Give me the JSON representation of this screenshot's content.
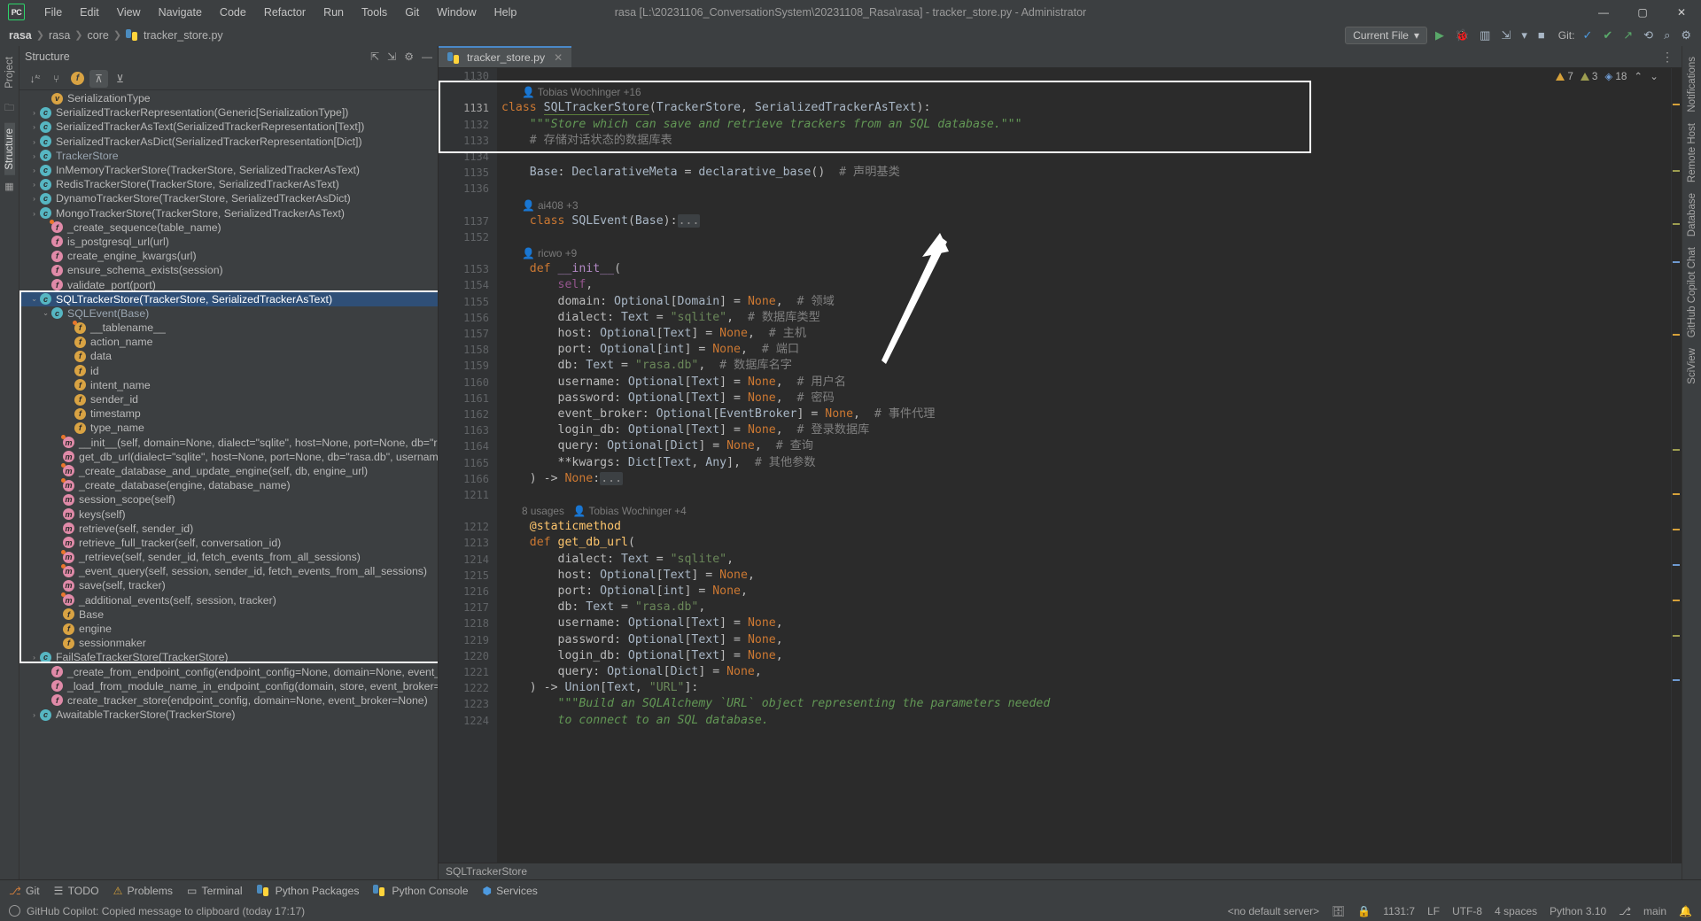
{
  "window": {
    "app_initials": "PC",
    "title": "rasa [L:\\20231106_ConversationSystem\\20231108_Rasa\\rasa] - tracker_store.py - Administrator",
    "controls": {
      "minimize": "—",
      "maximize": "▢",
      "close": "✕"
    }
  },
  "menu": [
    "File",
    "Edit",
    "View",
    "Navigate",
    "Code",
    "Refactor",
    "Run",
    "Tools",
    "Git",
    "Window",
    "Help"
  ],
  "breadcrumb": {
    "items": [
      "rasa",
      "rasa",
      "core"
    ],
    "file": "tracker_store.py",
    "file_icon": "python-file-icon"
  },
  "navbar_right": {
    "run_config": "Current File",
    "chevron": "▾",
    "run": "▶",
    "debug": "bug-icon",
    "coverage": "coverage-icon",
    "profile": "profile-icon",
    "more": "▾",
    "stop": "■",
    "git_label": "Git:",
    "git_update": "✓",
    "git_commit": "✔",
    "git_push": "↗",
    "history": "⟲",
    "search_everywhere": "⌕",
    "settings": "⚙",
    "menu_more": "⋮"
  },
  "structure": {
    "title": "Structure",
    "header_icons": [
      "expand-all-icon",
      "collapse-all-icon",
      "settings-icon",
      "hide-icon"
    ],
    "toolbar": [
      {
        "name": "sort-alphabetically-icon",
        "glyph": "↓ᴬᶻ",
        "active": false
      },
      {
        "name": "sort-by-visibility-icon",
        "glyph": "⑂",
        "active": false
      },
      {
        "name": "show-fields-icon",
        "glyph": "f",
        "active": true
      },
      {
        "name": "show-inherited-icon",
        "glyph": "⊼",
        "active": true
      },
      {
        "name": "show-non-public-icon",
        "glyph": "⊻",
        "active": false
      }
    ],
    "nodes": [
      {
        "indent": 1,
        "arrow": "",
        "kind": "var",
        "label": "SerializationType",
        "muted": false
      },
      {
        "indent": 0,
        "arrow": "›",
        "kind": "class",
        "label": "SerializedTrackerRepresentation(Generic[SerializationType])",
        "muted": false
      },
      {
        "indent": 0,
        "arrow": "›",
        "kind": "class",
        "label": "SerializedTrackerAsText(SerializedTrackerRepresentation[Text])",
        "muted": false
      },
      {
        "indent": 0,
        "arrow": "›",
        "kind": "class",
        "label": "SerializedTrackerAsDict(SerializedTrackerRepresentation[Dict])",
        "muted": false
      },
      {
        "indent": 0,
        "arrow": "›",
        "kind": "class",
        "label": "TrackerStore",
        "muted": true
      },
      {
        "indent": 0,
        "arrow": "›",
        "kind": "class",
        "label": "InMemoryTrackerStore(TrackerStore, SerializedTrackerAsText)",
        "muted": false
      },
      {
        "indent": 0,
        "arrow": "›",
        "kind": "class",
        "label": "RedisTrackerStore(TrackerStore, SerializedTrackerAsText)",
        "muted": false
      },
      {
        "indent": 0,
        "arrow": "›",
        "kind": "class",
        "label": "DynamoTrackerStore(TrackerStore, SerializedTrackerAsDict)",
        "muted": false
      },
      {
        "indent": 0,
        "arrow": "›",
        "kind": "class",
        "label": "MongoTrackerStore(TrackerStore, SerializedTrackerAsText)",
        "muted": false
      },
      {
        "indent": 1,
        "arrow": "",
        "kind": "func",
        "label": "_create_sequence(table_name)",
        "dot": true
      },
      {
        "indent": 1,
        "arrow": "",
        "kind": "func",
        "label": "is_postgresql_url(url)"
      },
      {
        "indent": 1,
        "arrow": "",
        "kind": "func",
        "label": "create_engine_kwargs(url)"
      },
      {
        "indent": 1,
        "arrow": "",
        "kind": "func",
        "label": "ensure_schema_exists(session)"
      },
      {
        "indent": 1,
        "arrow": "",
        "kind": "func",
        "label": "validate_port(port)"
      },
      {
        "indent": 0,
        "arrow": "⌄",
        "kind": "class",
        "label": "SQLTrackerStore(TrackerStore, SerializedTrackerAsText)",
        "selected": true
      },
      {
        "indent": 1,
        "arrow": "⌄",
        "kind": "class",
        "label": "SQLEvent(Base)",
        "muted": true
      },
      {
        "indent": 3,
        "arrow": "",
        "kind": "field",
        "label": "__tablename__",
        "dot": true
      },
      {
        "indent": 3,
        "arrow": "",
        "kind": "field",
        "label": "action_name"
      },
      {
        "indent": 3,
        "arrow": "",
        "kind": "field",
        "label": "data"
      },
      {
        "indent": 3,
        "arrow": "",
        "kind": "field",
        "label": "id"
      },
      {
        "indent": 3,
        "arrow": "",
        "kind": "field",
        "label": "intent_name"
      },
      {
        "indent": 3,
        "arrow": "",
        "kind": "field",
        "label": "sender_id"
      },
      {
        "indent": 3,
        "arrow": "",
        "kind": "field",
        "label": "timestamp"
      },
      {
        "indent": 3,
        "arrow": "",
        "kind": "field",
        "label": "type_name"
      },
      {
        "indent": 2,
        "arrow": "",
        "kind": "meth",
        "label": "__init__(self, domain=None, dialect=\"sqlite\", host=None, port=None, db=\"rasa.db\", usern",
        "dot": true
      },
      {
        "indent": 2,
        "arrow": "",
        "kind": "meth",
        "label": "get_db_url(dialect=\"sqlite\", host=None, port=None, db=\"rasa.db\", username=None, pass"
      },
      {
        "indent": 2,
        "arrow": "",
        "kind": "meth",
        "label": "_create_database_and_update_engine(self, db, engine_url)",
        "dot": true
      },
      {
        "indent": 2,
        "arrow": "",
        "kind": "meth",
        "label": "_create_database(engine, database_name)",
        "dot": true
      },
      {
        "indent": 2,
        "arrow": "",
        "kind": "meth",
        "label": "session_scope(self)"
      },
      {
        "indent": 2,
        "arrow": "",
        "kind": "meth",
        "label": "keys(self)"
      },
      {
        "indent": 2,
        "arrow": "",
        "kind": "meth",
        "label": "retrieve(self, sender_id)"
      },
      {
        "indent": 2,
        "arrow": "",
        "kind": "meth",
        "label": "retrieve_full_tracker(self, conversation_id)"
      },
      {
        "indent": 2,
        "arrow": "",
        "kind": "meth",
        "label": "_retrieve(self, sender_id, fetch_events_from_all_sessions)",
        "dot": true
      },
      {
        "indent": 2,
        "arrow": "",
        "kind": "meth",
        "label": "_event_query(self, session, sender_id, fetch_events_from_all_sessions)",
        "dot": true
      },
      {
        "indent": 2,
        "arrow": "",
        "kind": "meth",
        "label": "save(self, tracker)"
      },
      {
        "indent": 2,
        "arrow": "",
        "kind": "meth",
        "label": "_additional_events(self, session, tracker)",
        "dot": true
      },
      {
        "indent": 2,
        "arrow": "",
        "kind": "field",
        "label": "Base"
      },
      {
        "indent": 2,
        "arrow": "",
        "kind": "field",
        "label": "engine"
      },
      {
        "indent": 2,
        "arrow": "",
        "kind": "field",
        "label": "sessionmaker"
      },
      {
        "indent": 0,
        "arrow": "›",
        "kind": "class",
        "label": "FailSafeTrackerStore(TrackerStore)"
      },
      {
        "indent": 1,
        "arrow": "",
        "kind": "func",
        "label": "_create_from_endpoint_config(endpoint_config=None, domain=None, event_broker=None)"
      },
      {
        "indent": 1,
        "arrow": "",
        "kind": "func",
        "label": "_load_from_module_name_in_endpoint_config(domain, store, event_broker=None)"
      },
      {
        "indent": 1,
        "arrow": "",
        "kind": "func",
        "label": "create_tracker_store(endpoint_config, domain=None, event_broker=None)"
      },
      {
        "indent": 0,
        "arrow": "›",
        "kind": "class",
        "label": "AwaitableTrackerStore(TrackerStore)"
      }
    ]
  },
  "editor": {
    "tab": {
      "label": "tracker_store.py",
      "icon": "python-file-icon",
      "close": "✕"
    },
    "tabbar_right_icon": "⋮",
    "inspection": {
      "warnings": "7",
      "weak_warnings": "3",
      "typos": "18",
      "caret_up": "⌃",
      "caret_down": "⌄"
    },
    "footer_breadcrumb": "SQLTrackerStore",
    "lines": [
      {
        "num": "1130",
        "type": "blank",
        "text": ""
      },
      {
        "num": "",
        "type": "annot",
        "author": "Tobias Wochinger",
        "extra": "+16"
      },
      {
        "num": "1131",
        "type": "code",
        "html": "<span class='kw'>class</span> <span class='cls underline-cls'>SQLTrackerStore</span>(<span class='ty'>TrackerStore</span>, <span class='ty'>SerializedTrackerAsText</span>):"
      },
      {
        "num": "1132",
        "type": "code",
        "html": "    <span class='doc'>\"\"\"Store which can save and retrieve trackers from an SQL database.\"\"\"</span>"
      },
      {
        "num": "1133",
        "type": "code",
        "html": "    <span class='cmt'># 存储对话状态的数据库表</span>"
      },
      {
        "num": "1134",
        "type": "code",
        "html": ""
      },
      {
        "num": "1135",
        "type": "code",
        "html": "    <span class='id'>Base</span>: <span class='ty'>DeclarativeMeta</span> = <span class='id'>declarative_base</span>()  <span class='cmt'># 声明基类</span>"
      },
      {
        "num": "1136",
        "type": "code",
        "html": ""
      },
      {
        "num": "",
        "type": "annot",
        "author": "ai408",
        "extra": "+3"
      },
      {
        "num": "1137",
        "type": "code",
        "html": "    <span class='kw'>class</span> <span class='cls'>SQLEvent</span>(<span class='ty'>Base</span>):<span class='fold'>...</span>",
        "fold": true
      },
      {
        "num": "1152",
        "type": "code",
        "html": ""
      },
      {
        "num": "",
        "type": "annot",
        "author": "ricwo",
        "extra": "+9"
      },
      {
        "num": "1153",
        "type": "code",
        "html": "    <span class='kw'>def</span> <span class='mgc'>__init__</span>("
      },
      {
        "num": "1154",
        "type": "code",
        "html": "        <span class='self'>self</span>,"
      },
      {
        "num": "1155",
        "type": "code",
        "html": "        domain: <span class='ty'>Optional</span>[<span class='ty'>Domain</span>] = <span class='kw'>None</span>,  <span class='cmt'># 领域</span>"
      },
      {
        "num": "1156",
        "type": "code",
        "html": "        dialect: <span class='ty'>Text</span> = <span class='str'>\"sqlite\"</span>,  <span class='cmt'># 数据库类型</span>"
      },
      {
        "num": "1157",
        "type": "code",
        "html": "        host: <span class='ty'>Optional</span>[<span class='ty'>Text</span>] = <span class='kw'>None</span>,  <span class='cmt'># 主机</span>"
      },
      {
        "num": "1158",
        "type": "code",
        "html": "        port: <span class='ty'>Optional</span>[<span class='ty'>int</span>] = <span class='kw'>None</span>,  <span class='cmt'># 端口</span>"
      },
      {
        "num": "1159",
        "type": "code",
        "html": "        db: <span class='ty'>Text</span> = <span class='str'>\"rasa.db\"</span>,  <span class='cmt'># 数据库名字</span>"
      },
      {
        "num": "1160",
        "type": "code",
        "html": "        username: <span class='ty'>Optional</span>[<span class='ty'>Text</span>] = <span class='kw'>None</span>,  <span class='cmt'># 用户名</span>"
      },
      {
        "num": "1161",
        "type": "code",
        "html": "        password: <span class='ty'>Optional</span>[<span class='ty'>Text</span>] = <span class='kw'>None</span>,  <span class='cmt'># 密码</span>"
      },
      {
        "num": "1162",
        "type": "code",
        "html": "        event_broker: <span class='ty'>Optional</span>[<span class='ty'>EventBroker</span>] = <span class='kw'>None</span>,  <span class='cmt'># 事件代理</span>"
      },
      {
        "num": "1163",
        "type": "code",
        "html": "        login_db: <span class='ty'>Optional</span>[<span class='ty'>Text</span>] = <span class='kw'>None</span>,  <span class='cmt'># 登录数据库</span>"
      },
      {
        "num": "1164",
        "type": "code",
        "html": "        query: <span class='ty'>Optional</span>[<span class='ty'>Dict</span>] = <span class='kw'>None</span>,  <span class='cmt'># 查询</span>"
      },
      {
        "num": "1165",
        "type": "code",
        "html": "        **kwargs: <span class='ty'>Dict</span>[<span class='ty'>Text</span>, <span class='ty'>Any</span>],  <span class='cmt'># 其他参数</span>"
      },
      {
        "num": "1166",
        "type": "code",
        "html": "    ) -> <span class='kw'>None</span>:<span class='fold'>...</span>",
        "fold": true
      },
      {
        "num": "1211",
        "type": "code",
        "html": ""
      },
      {
        "num": "",
        "type": "annot",
        "usages": "8 usages",
        "author": "Tobias Wochinger",
        "extra": "+4"
      },
      {
        "num": "1212",
        "type": "code",
        "html": "    <span class='fn'>@staticmethod</span>"
      },
      {
        "num": "1213",
        "type": "code",
        "html": "    <span class='kw'>def</span> <span class='fn'>get_db_url</span>("
      },
      {
        "num": "1214",
        "type": "code",
        "html": "        dialect: <span class='ty'>Text</span> = <span class='str'>\"sqlite\"</span>,"
      },
      {
        "num": "1215",
        "type": "code",
        "html": "        host: <span class='ty'>Optional</span>[<span class='ty'>Text</span>] = <span class='kw'>None</span>,"
      },
      {
        "num": "1216",
        "type": "code",
        "html": "        port: <span class='ty'>Optional</span>[<span class='ty'>int</span>] = <span class='kw'>None</span>,"
      },
      {
        "num": "1217",
        "type": "code",
        "html": "        db: <span class='ty'>Text</span> = <span class='str'>\"rasa.db\"</span>,"
      },
      {
        "num": "1218",
        "type": "code",
        "html": "        username: <span class='ty'>Optional</span>[<span class='ty'>Text</span>] = <span class='kw'>None</span>,"
      },
      {
        "num": "1219",
        "type": "code",
        "html": "        password: <span class='ty'>Optional</span>[<span class='ty'>Text</span>] = <span class='kw'>None</span>,"
      },
      {
        "num": "1220",
        "type": "code",
        "html": "        login_db: <span class='ty'>Optional</span>[<span class='ty'>Text</span>] = <span class='kw'>None</span>,"
      },
      {
        "num": "1221",
        "type": "code",
        "html": "        query: <span class='ty'>Optional</span>[<span class='ty'>Dict</span>] = <span class='kw'>None</span>,"
      },
      {
        "num": "1222",
        "type": "code",
        "html": "    ) -> <span class='ty'>Union</span>[<span class='ty'>Text</span>, <span class='str'>\"URL\"</span>]:"
      },
      {
        "num": "1223",
        "type": "code",
        "html": "        <span class='doc'>\"\"\"Build an SQLAlchemy `URL` object representing the parameters needed</span>"
      },
      {
        "num": "1224",
        "type": "code",
        "html": "        <span class='doc'>to connect to an SQL database.</span>"
      }
    ]
  },
  "toolwindows": [
    {
      "icon": "git-icon",
      "label": "Git"
    },
    {
      "icon": "todo-icon",
      "label": "TODO"
    },
    {
      "icon": "problems-icon",
      "label": "Problems"
    },
    {
      "icon": "terminal-icon",
      "label": "Terminal"
    },
    {
      "icon": "python-packages-icon",
      "label": "Python Packages"
    },
    {
      "icon": "python-console-icon",
      "label": "Python Console"
    },
    {
      "icon": "services-icon",
      "label": "Services"
    }
  ],
  "right_rail": [
    "Notifications",
    "Remote Host",
    "Database",
    "GitHub Copilot Chat",
    "SciView"
  ],
  "left_rail": [
    "Project",
    "Structure"
  ],
  "statusbar": {
    "message": "GitHub Copilot: Copied message to clipboard (today 17:17)",
    "interpreter_placeholder": "<no default server>",
    "caret_position": "1131:7",
    "line_separator": "LF",
    "encoding": "UTF-8",
    "indent": "4 spaces",
    "python_version": "Python 3.10",
    "branch": "main",
    "lock_icon": "lock-icon",
    "db_icon": "database-icon"
  }
}
